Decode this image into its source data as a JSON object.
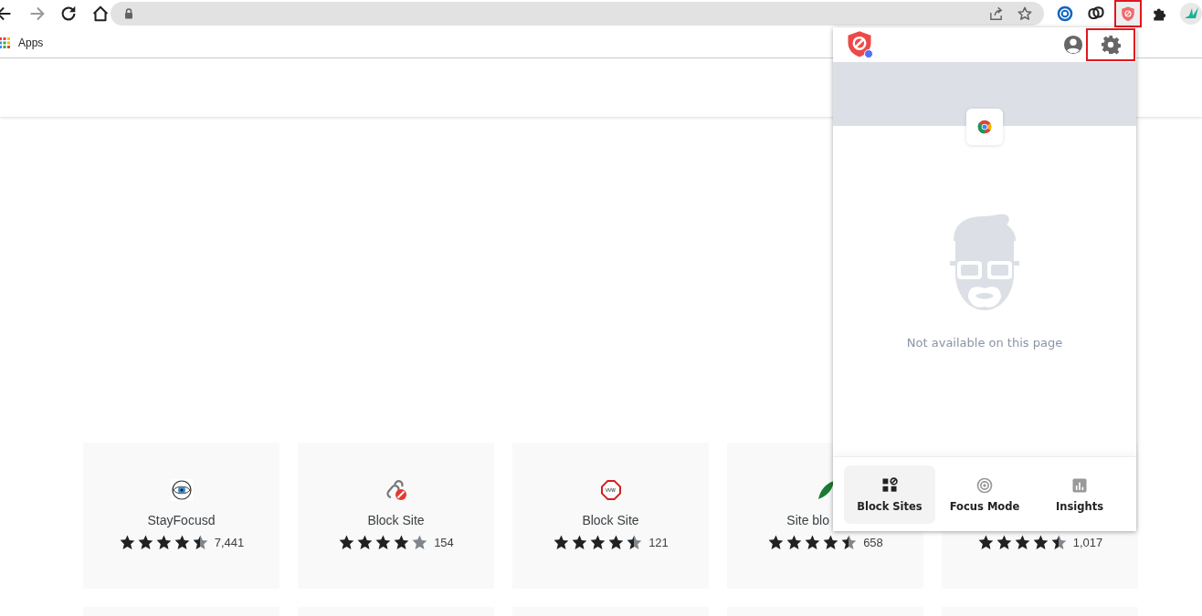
{
  "navigation": [
    {
      "kind": "back",
      "disabled": false
    },
    {
      "kind": "forward",
      "disabled": true
    },
    {
      "kind": "reload",
      "disabled": false
    },
    {
      "kind": "home",
      "disabled": false
    }
  ],
  "extensions": [
    {
      "kind": "letter",
      "highlighted": false
    },
    {
      "kind": "rings",
      "highlighted": false
    },
    {
      "kind": "shield",
      "highlighted": true
    },
    {
      "kind": "puzzle",
      "highlighted": false
    },
    {
      "kind": "avatar",
      "highlighted": false
    }
  ],
  "bookmarks": [
    {
      "label": "Apps"
    }
  ],
  "cards": [
    {
      "title": "StayFocusd",
      "stars": 4.5,
      "count": "7,441"
    },
    {
      "title": "Block Site",
      "stars": 4,
      "count": "154"
    },
    {
      "title": "Block Site",
      "stars": 4.5,
      "count": "121"
    },
    {
      "title": "Site blo",
      "stars": 4.5,
      "count": "658"
    },
    {
      "stars": 4.5,
      "count": "1,017"
    }
  ],
  "popup": {
    "settings_highlighted": true,
    "message": "Not available on this page",
    "tabs": [
      {
        "label": "Block Sites",
        "selected": true
      },
      {
        "label": "Focus Mode",
        "selected": false
      },
      {
        "label": "Insights",
        "selected": false
      }
    ]
  }
}
